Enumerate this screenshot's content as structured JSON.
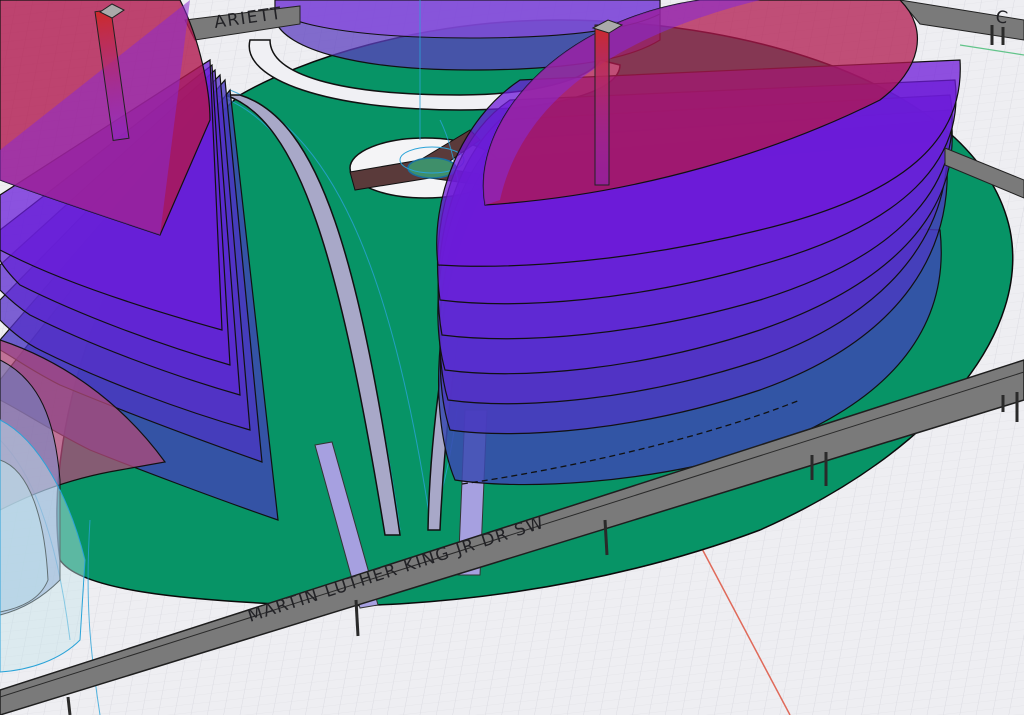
{
  "viewport": {
    "kind": "3D modeling viewport"
  },
  "streets": {
    "main_label": "MARTIN LUTHER KING JR DR SW",
    "top_label_fragment": "ARIETT",
    "top_right_fragment": "C"
  },
  "colors": {
    "ground": "#eeeef2",
    "grid_minor": "#d9d9e0",
    "grid_major": "#c6c6cf",
    "site": "#079466",
    "road": "#7a7a7a",
    "road_edge": "#2a2a2a",
    "tower_fill": "#6a1fd6",
    "tower_top": "#b0184e",
    "axis_red": "#e06a5a",
    "axis_green": "#62c48a",
    "guide_blue": "#2aa3d8",
    "core": "#8a8a8a"
  }
}
